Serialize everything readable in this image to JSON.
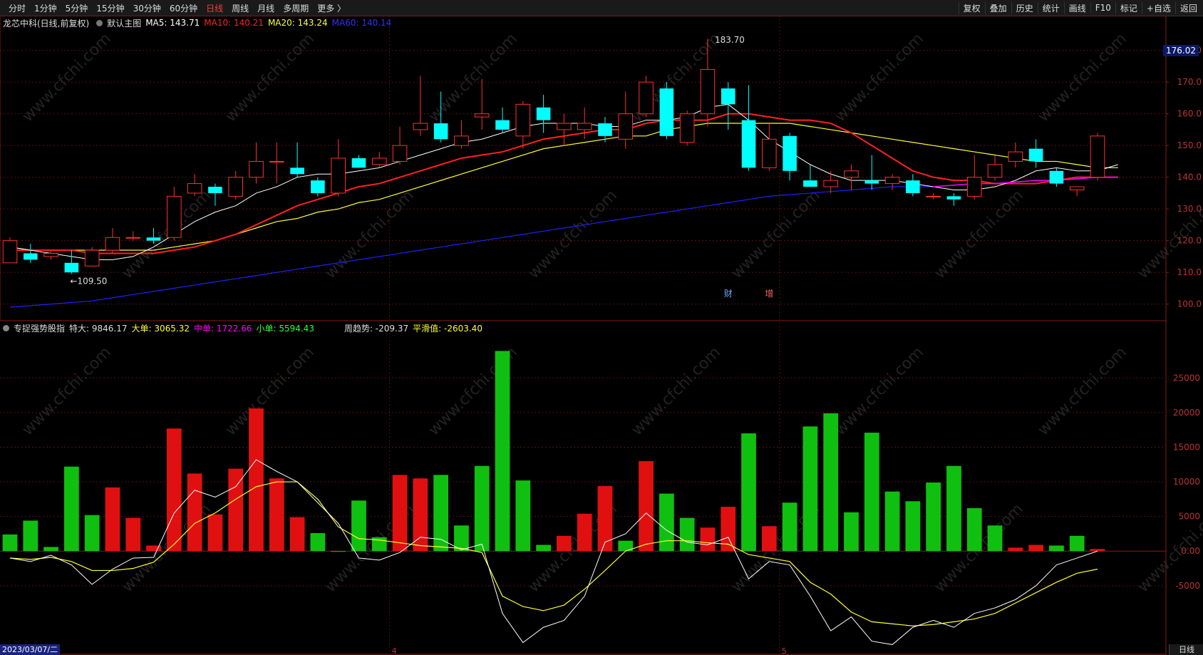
{
  "toolbar": {
    "tabs": [
      "分时",
      "1分钟",
      "5分钟",
      "15分钟",
      "30分钟",
      "60分钟",
      "日线",
      "周线",
      "月线",
      "多周期",
      "更多 〉"
    ],
    "active_tab": "日线",
    "tools": [
      "复权",
      "叠加",
      "历史",
      "统计",
      "画线",
      "F10",
      "标记",
      "+自选",
      "返回"
    ]
  },
  "main_legend": {
    "stock": "龙芯中科(日线,前复权)",
    "template": "默认主图",
    "ma5": "MA5: 143.71",
    "ma10": "MA10: 140.21",
    "ma20": "MA20: 143.24",
    "ma60": "MA60: 140.14"
  },
  "sub_legend": {
    "name": "专捉强势股指",
    "te_da": "特大: 9846.17",
    "da_dan": "大单: 3065.32",
    "zhong_dan": "中单: 1722.66",
    "xiao_dan": "小单: 5594.43",
    "zhou_qushi": "周趋势: -209.37",
    "pinghua": "平滑值: -2603.40"
  },
  "current_price": "176.02",
  "date_label": "2023/03/07/二",
  "period_label": "日线",
  "watermark": "www.cfchi.com",
  "colors": {
    "up": "#ff3030",
    "down": "#00ffff",
    "ma5": "#ffffff",
    "ma10": "#ff2020",
    "ma20": "#ffff33",
    "ma60": "#2020ff",
    "ma_recent": "#ff00ff",
    "bar_up": "#e01010",
    "bar_down": "#10c010"
  },
  "chart_data": [
    {
      "type": "candlestick",
      "y_ticks": [
        100,
        110,
        120,
        130,
        140,
        150,
        160,
        170,
        180
      ],
      "ylim": [
        97,
        186
      ],
      "annotations": [
        {
          "label": "183.70",
          "index": 34
        },
        {
          "label": "←109.50",
          "index": 3
        }
      ],
      "markers": [
        {
          "label": "财",
          "index": 35
        },
        {
          "label": "增",
          "index": 37
        }
      ],
      "month_labels": [
        {
          "label": "4",
          "index": 19
        },
        {
          "label": "5",
          "index": 38
        }
      ],
      "candles": [
        {
          "o": 113,
          "h": 121,
          "l": 113,
          "c": 120
        },
        {
          "o": 116,
          "h": 119,
          "l": 113,
          "c": 114
        },
        {
          "o": 115,
          "h": 117,
          "l": 114,
          "c": 116
        },
        {
          "o": 113,
          "h": 117,
          "l": 109.5,
          "c": 110
        },
        {
          "o": 112,
          "h": 118,
          "l": 112,
          "c": 117
        },
        {
          "o": 117,
          "h": 124,
          "l": 116,
          "c": 121
        },
        {
          "o": 121,
          "h": 123,
          "l": 120,
          "c": 121
        },
        {
          "o": 121,
          "h": 124,
          "l": 119,
          "c": 120
        },
        {
          "o": 121,
          "h": 137,
          "l": 120,
          "c": 134
        },
        {
          "o": 135,
          "h": 141,
          "l": 134,
          "c": 138
        },
        {
          "o": 137,
          "h": 138,
          "l": 131,
          "c": 135
        },
        {
          "o": 134,
          "h": 142,
          "l": 133,
          "c": 140
        },
        {
          "o": 140,
          "h": 151,
          "l": 138,
          "c": 145
        },
        {
          "o": 145,
          "h": 151,
          "l": 138,
          "c": 145
        },
        {
          "o": 143,
          "h": 151,
          "l": 140,
          "c": 141
        },
        {
          "o": 139,
          "h": 140,
          "l": 134,
          "c": 135
        },
        {
          "o": 135,
          "h": 152,
          "l": 134,
          "c": 146
        },
        {
          "o": 146,
          "h": 147,
          "l": 143,
          "c": 143
        },
        {
          "o": 144,
          "h": 148,
          "l": 143,
          "c": 146
        },
        {
          "o": 145,
          "h": 156,
          "l": 144,
          "c": 150
        },
        {
          "o": 155,
          "h": 172,
          "l": 153,
          "c": 157
        },
        {
          "o": 157,
          "h": 167,
          "l": 151,
          "c": 152
        },
        {
          "o": 150,
          "h": 158,
          "l": 149,
          "c": 153
        },
        {
          "o": 159,
          "h": 171,
          "l": 155,
          "c": 160
        },
        {
          "o": 158,
          "h": 162,
          "l": 154,
          "c": 155
        },
        {
          "o": 153,
          "h": 164,
          "l": 149,
          "c": 163
        },
        {
          "o": 162,
          "h": 166,
          "l": 154,
          "c": 158
        },
        {
          "o": 155,
          "h": 160,
          "l": 150,
          "c": 157
        },
        {
          "o": 155,
          "h": 162,
          "l": 152,
          "c": 157
        },
        {
          "o": 157,
          "h": 159,
          "l": 151,
          "c": 153
        },
        {
          "o": 152,
          "h": 167,
          "l": 149,
          "c": 160
        },
        {
          "o": 160,
          "h": 172,
          "l": 159,
          "c": 170
        },
        {
          "o": 168,
          "h": 170,
          "l": 152,
          "c": 153
        },
        {
          "o": 151,
          "h": 161,
          "l": 150,
          "c": 160
        },
        {
          "o": 160,
          "h": 183.7,
          "l": 156,
          "c": 174
        },
        {
          "o": 168,
          "h": 170,
          "l": 155,
          "c": 163
        },
        {
          "o": 158,
          "h": 169,
          "l": 142,
          "c": 143
        },
        {
          "o": 143,
          "h": 157,
          "l": 142,
          "c": 152
        },
        {
          "o": 153,
          "h": 154,
          "l": 139,
          "c": 142
        },
        {
          "o": 139,
          "h": 144,
          "l": 137,
          "c": 137
        },
        {
          "o": 137,
          "h": 142,
          "l": 135,
          "c": 139
        },
        {
          "o": 140,
          "h": 144,
          "l": 136,
          "c": 142
        },
        {
          "o": 139,
          "h": 147,
          "l": 136,
          "c": 138
        },
        {
          "o": 138,
          "h": 141,
          "l": 136,
          "c": 140
        },
        {
          "o": 139,
          "h": 141,
          "l": 134,
          "c": 135
        },
        {
          "o": 134,
          "h": 135,
          "l": 133,
          "c": 134
        },
        {
          "o": 134,
          "h": 135,
          "l": 131,
          "c": 133
        },
        {
          "o": 134,
          "h": 147,
          "l": 133,
          "c": 140
        },
        {
          "o": 140,
          "h": 147,
          "l": 139,
          "c": 144
        },
        {
          "o": 145,
          "h": 151,
          "l": 143,
          "c": 148
        },
        {
          "o": 149,
          "h": 152,
          "l": 143,
          "c": 145
        },
        {
          "o": 142,
          "h": 143,
          "l": 137,
          "c": 138
        },
        {
          "o": 136,
          "h": 137,
          "l": 134,
          "c": 137
        },
        {
          "o": 140,
          "h": 154,
          "l": 139,
          "c": 153
        }
      ],
      "ma5": [
        118,
        117,
        116,
        115,
        114,
        114,
        115,
        118,
        122,
        126,
        129,
        131,
        135,
        137,
        140,
        141,
        141,
        142,
        143,
        145,
        147,
        149,
        151,
        152,
        154,
        156,
        157,
        157,
        157,
        156,
        156,
        158,
        158,
        159,
        162,
        163,
        158,
        152,
        148,
        144,
        141,
        139,
        139,
        139,
        138,
        137,
        136,
        136,
        137,
        139,
        142,
        143,
        142,
        142,
        144
      ],
      "ma10": [
        117,
        117,
        117,
        117,
        116,
        116,
        116,
        116,
        117,
        118,
        120,
        122,
        125,
        128,
        131,
        133,
        135,
        137,
        138,
        140,
        142,
        144,
        146,
        147,
        148,
        150,
        152,
        153,
        154,
        155,
        155,
        157,
        158,
        158,
        158,
        160,
        160,
        159,
        158,
        158,
        157,
        154,
        150,
        146,
        142,
        140,
        139,
        139,
        138,
        138,
        138,
        139,
        140,
        140,
        140
      ],
      "ma20": [
        118,
        117,
        117,
        117,
        117,
        117,
        117,
        117,
        118,
        119,
        120,
        122,
        124,
        126,
        127,
        129,
        130,
        132,
        133,
        135,
        137,
        139,
        141,
        143,
        145,
        147,
        149,
        150,
        151,
        152,
        153,
        153,
        155,
        156,
        157,
        157,
        157,
        157,
        157,
        156,
        155,
        154,
        153,
        152,
        151,
        150,
        149,
        148,
        147,
        146,
        145,
        145,
        144,
        143,
        143
      ],
      "ma60": [
        99,
        99.5,
        100,
        100.5,
        101,
        102,
        103,
        104,
        105,
        106,
        107,
        108,
        109,
        110,
        111,
        112,
        113,
        114,
        115,
        116,
        117,
        118,
        119,
        120,
        121,
        122,
        123,
        124,
        125,
        126,
        127,
        128,
        129,
        130,
        131,
        132,
        133,
        134,
        134.5,
        135,
        135.5,
        136,
        136.5,
        137,
        137,
        137,
        137.5,
        138,
        138,
        138.5,
        139,
        139,
        139.5,
        140,
        140
      ]
    },
    {
      "type": "bar",
      "y_ticks": [
        -5000,
        0,
        5000,
        10000,
        15000,
        20000,
        25000
      ],
      "ylim": [
        -15000,
        31000
      ],
      "values": [
        2400,
        4400,
        600,
        12200,
        5200,
        9200,
        4800,
        800,
        17700,
        11200,
        5300,
        11900,
        20600,
        10500,
        4900,
        2600,
        0,
        7300,
        2000,
        11000,
        10500,
        11000,
        3700,
        12300,
        28900,
        10200,
        900,
        2200,
        5400,
        9400,
        1500,
        13000,
        8300,
        4800,
        3400,
        6400,
        17000,
        3600,
        7000,
        18000,
        19900,
        5600,
        17100,
        8600,
        7200,
        9900,
        12300,
        6200,
        3700,
        500,
        900,
        800,
        2200,
        300
      ],
      "up": [
        false,
        false,
        false,
        false,
        false,
        true,
        true,
        true,
        true,
        true,
        true,
        true,
        true,
        true,
        true,
        false,
        false,
        false,
        false,
        true,
        true,
        false,
        false,
        false,
        false,
        false,
        false,
        true,
        true,
        true,
        false,
        true,
        false,
        false,
        true,
        true,
        false,
        true,
        false,
        false,
        false,
        false,
        false,
        false,
        false,
        false,
        false,
        false,
        false,
        true,
        true,
        false,
        false,
        true
      ],
      "line_white": [
        -1000,
        -1500,
        -600,
        -2000,
        -4800,
        -2600,
        -1000,
        -900,
        5500,
        8800,
        7800,
        9300,
        13200,
        11500,
        10000,
        7000,
        4000,
        -1000,
        -1300,
        -200,
        2000,
        1700,
        200,
        1000,
        -9000,
        -13200,
        -11000,
        -10000,
        -6500,
        1300,
        2500,
        5500,
        3000,
        1300,
        900,
        2000,
        -4000,
        -1500,
        -2000,
        -6500,
        -11500,
        -9500,
        -13000,
        -13500,
        -11000,
        -10000,
        -11000,
        -9000,
        -8200,
        -7000,
        -5000,
        -2000,
        -1000,
        0
      ],
      "line_yellow": [
        -1000,
        -1200,
        -900,
        -1500,
        -2800,
        -2800,
        -2500,
        -1600,
        1000,
        4000,
        5500,
        7500,
        9300,
        10000,
        10000,
        7500,
        3500,
        1800,
        1600,
        1200,
        800,
        600,
        400,
        -200,
        -6500,
        -8000,
        -8600,
        -7800,
        -5500,
        -2800,
        0,
        1000,
        1500,
        1500,
        1200,
        1000,
        -500,
        -1000,
        -1500,
        -4500,
        -6200,
        -8800,
        -10200,
        -10500,
        -10800,
        -10600,
        -10200,
        -9800,
        -9000,
        -7500,
        -6000,
        -4500,
        -3200,
        -2600
      ]
    }
  ]
}
